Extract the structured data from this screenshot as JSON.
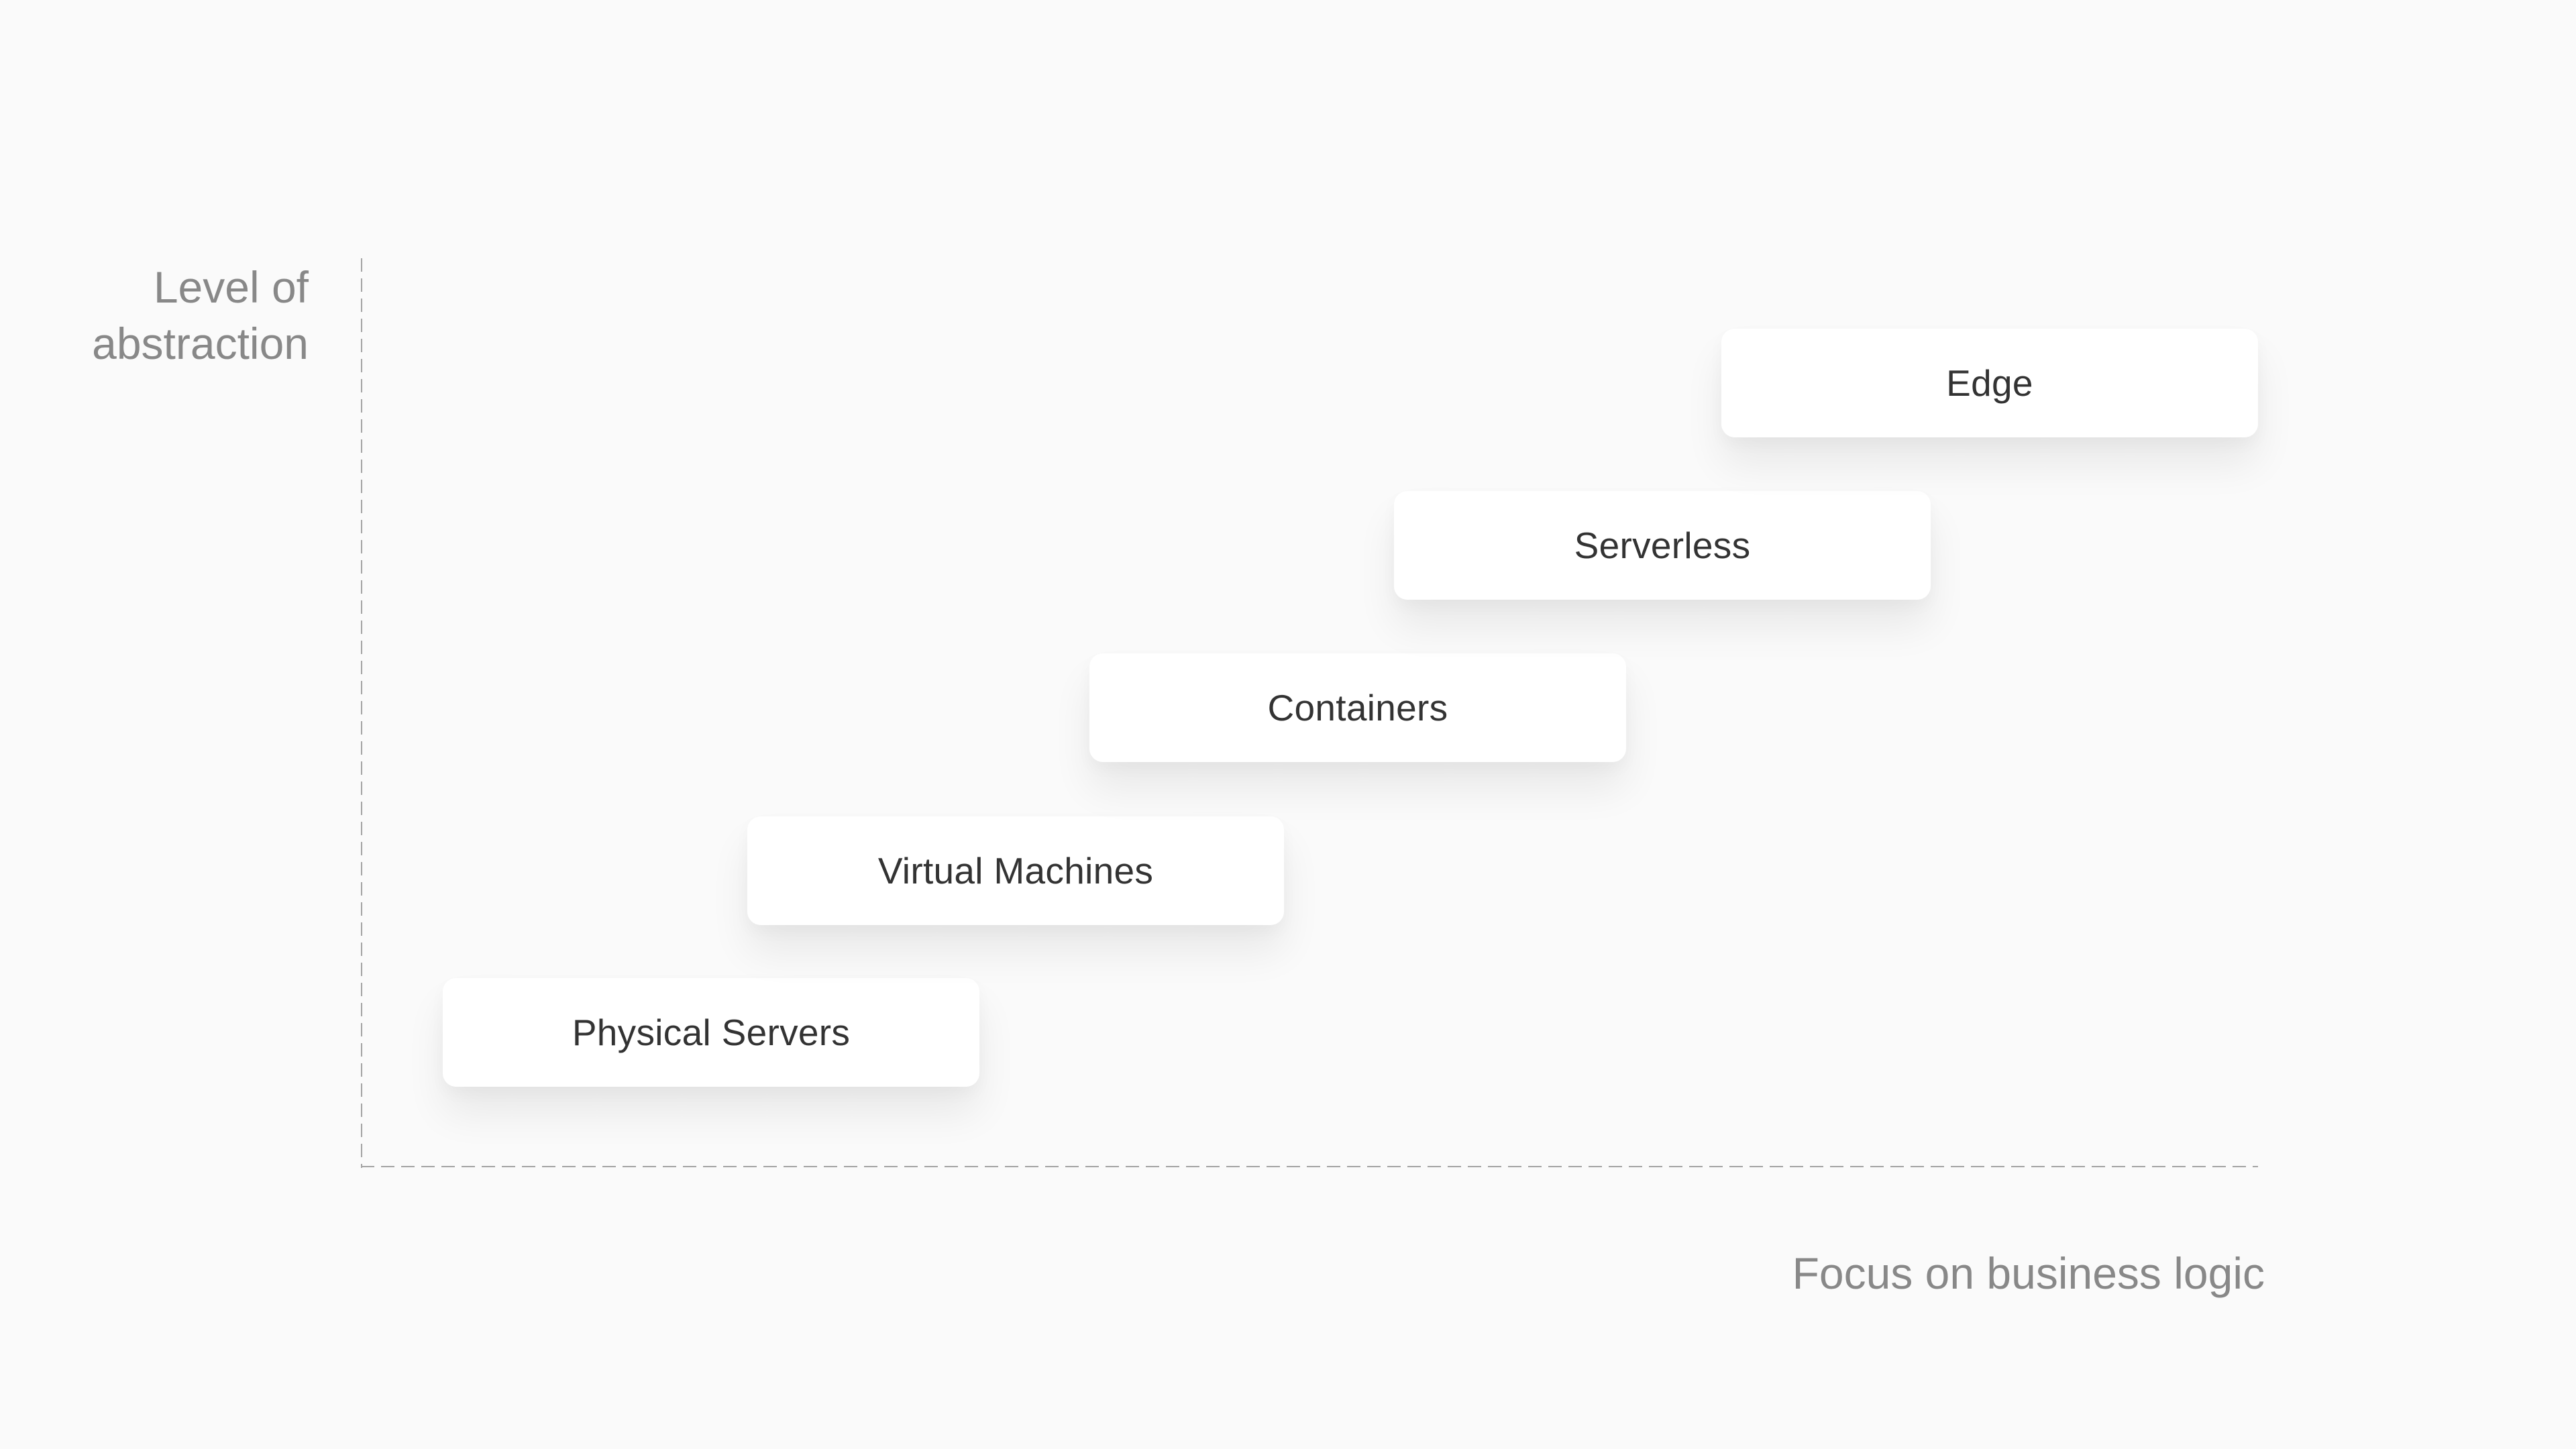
{
  "diagram": {
    "y_axis_label": {
      "line1": "Level of",
      "line2": "abstraction"
    },
    "x_axis_label": "Focus on business logic",
    "steps": [
      {
        "label": "Physical Servers",
        "level": 1
      },
      {
        "label": "Virtual Machines",
        "level": 2
      },
      {
        "label": "Containers",
        "level": 3
      },
      {
        "label": "Serverless",
        "level": 4
      },
      {
        "label": "Edge",
        "level": 5
      }
    ]
  },
  "colors": {
    "background": "#fafafa",
    "card_background": "#ffffff",
    "card_text": "#333333",
    "axis_label": "#888888",
    "axis_line": "#a3a3a3"
  }
}
